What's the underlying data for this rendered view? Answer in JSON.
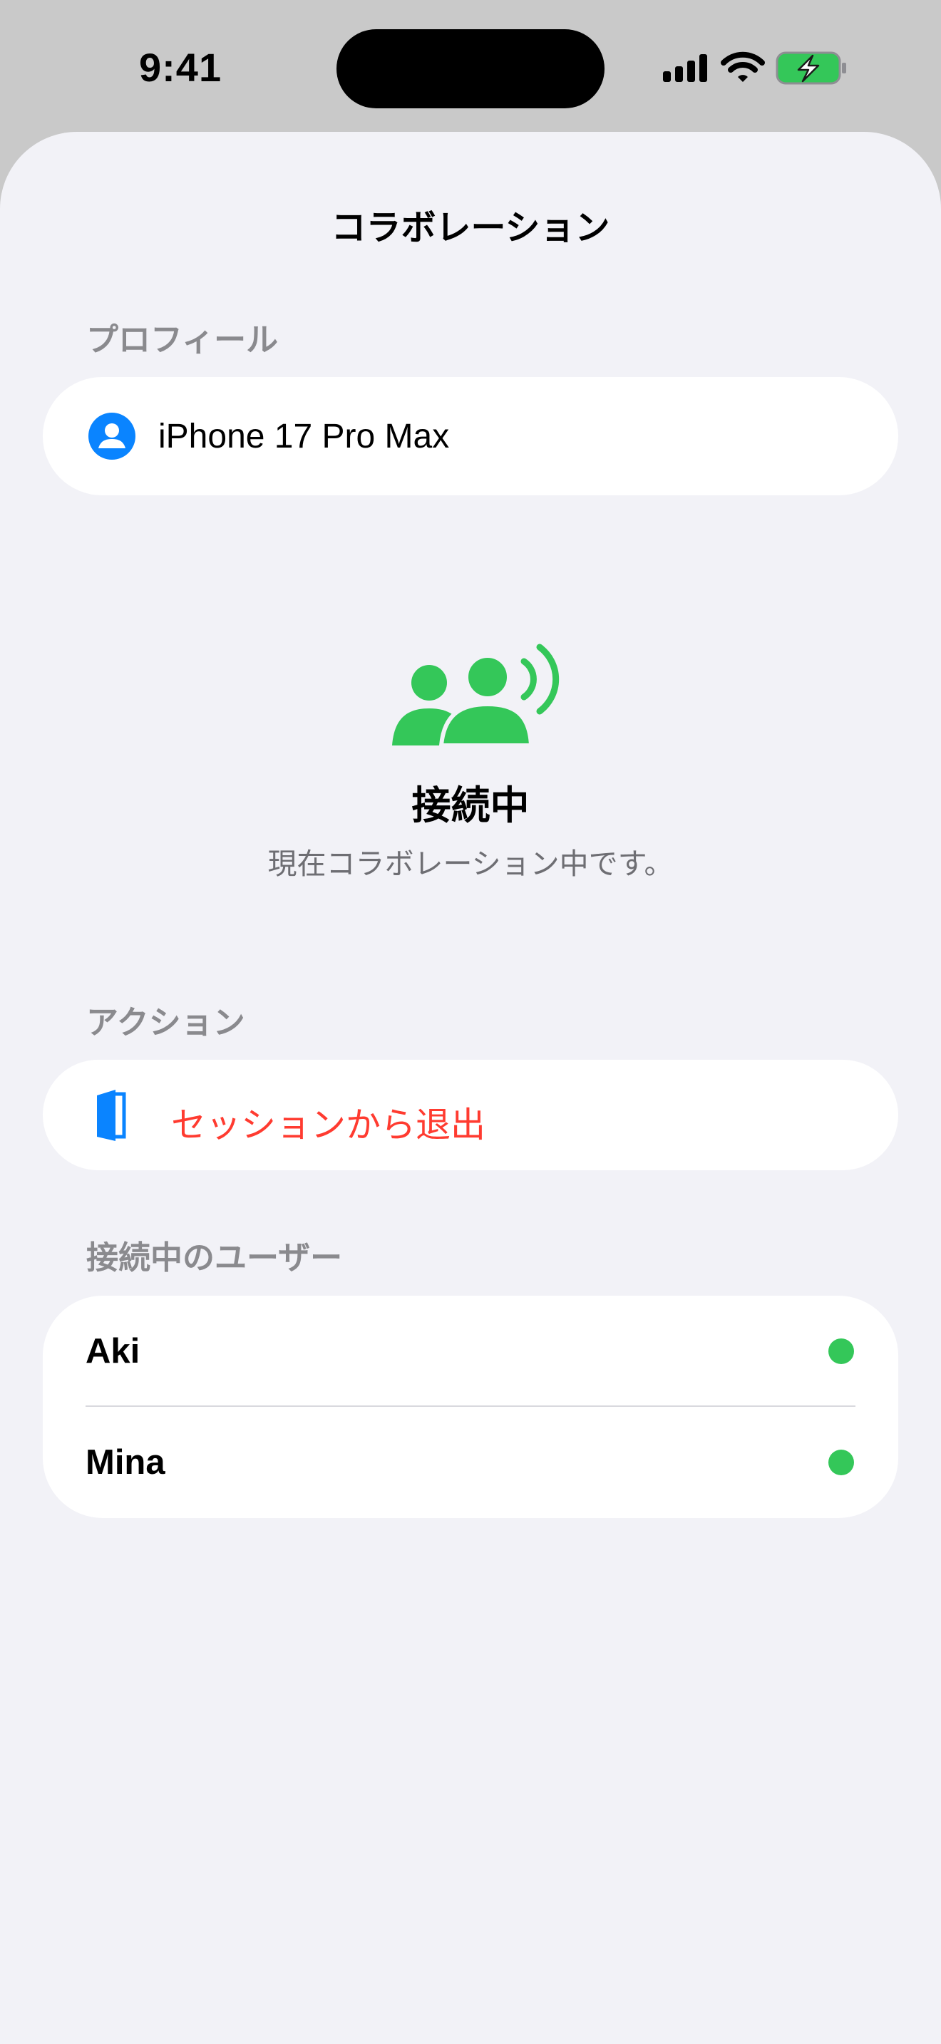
{
  "status_bar": {
    "time": "9:41"
  },
  "nav": {
    "title": "コラボレーション"
  },
  "profile": {
    "header": "プロフィール",
    "device_name": "iPhone 17 Pro Max",
    "icon": "person-circle-icon"
  },
  "connection": {
    "icon": "people-broadcast-icon",
    "title": "接続中",
    "subtitle": "現在コラボレーション中です。",
    "accent_color": "#34c759"
  },
  "actions": {
    "header": "アクション",
    "leave_label": "セッションから退出",
    "leave_icon": "door-icon",
    "leave_color": "#ff3b30"
  },
  "users": {
    "header": "接続中のユーザー",
    "items": [
      {
        "name": "Aki",
        "online": true
      },
      {
        "name": "Mina",
        "online": true
      }
    ]
  }
}
